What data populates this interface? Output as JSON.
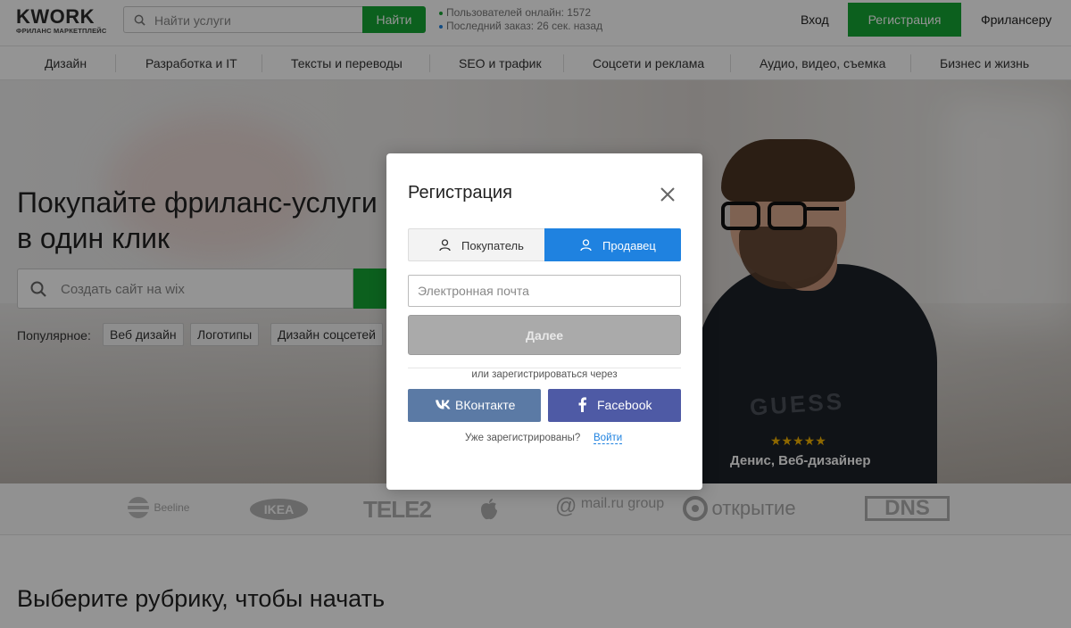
{
  "header": {
    "logo_text": "KWORK",
    "logo_subtitle": "ФРИЛАНС МАРКЕТПЛЕЙС",
    "search_placeholder": "Найти услуги",
    "search_button": "Найти",
    "stats": [
      {
        "text": "Пользователей онлайн: 1572",
        "dot_color": "#16a534"
      },
      {
        "text": "Последний заказ: 26 сек. назад",
        "dot_color": "#1f82e0"
      }
    ],
    "login": "Вход",
    "register": "Регистрация",
    "freelancer": "Фрилансеру"
  },
  "categories": [
    "Дизайн",
    "Разработка и IT",
    "Тексты и переводы",
    "SEO и трафик",
    "Соцсети и реклама",
    "Аудио, видео, съемка",
    "Бизнес и жизнь"
  ],
  "hero": {
    "title": "Покупайте фриланс-услуги в один клик",
    "search_placeholder": "Создать сайт на wix",
    "popular_label": "Популярное:",
    "popular_chips": [
      "Веб дизайн",
      "Логотипы",
      "Дизайн соцсетей"
    ],
    "rating_stars": 5,
    "stars_text": "★★★★★",
    "person_caption": "Денис, Веб-дизайнер",
    "shirt_print": "GUESS"
  },
  "brands": [
    "Beeline",
    "IKEA",
    "TELE2",
    "Apple",
    "mail.ru group",
    "открытие",
    "DNS"
  ],
  "section_title": "Выберите рубрику, чтобы начать",
  "modal": {
    "title": "Регистрация",
    "tabs": {
      "buyer": "Покупатель",
      "seller": "Продавец"
    },
    "active_tab": "seller",
    "email_placeholder": "Электронная почта",
    "next_button": "Далее",
    "divider_text": "или зарегистрироваться через",
    "vk_button": "ВКонтакте",
    "fb_button": "Facebook",
    "already_text": "Уже зарегистрированы?",
    "login_link": "Войти"
  },
  "colors": {
    "brand_green": "#16a534",
    "accent_blue": "#1f82e0",
    "vk_blue": "#5b7aa5",
    "fb_blue": "#4e5aa5",
    "star_yellow": "#f4b400"
  }
}
